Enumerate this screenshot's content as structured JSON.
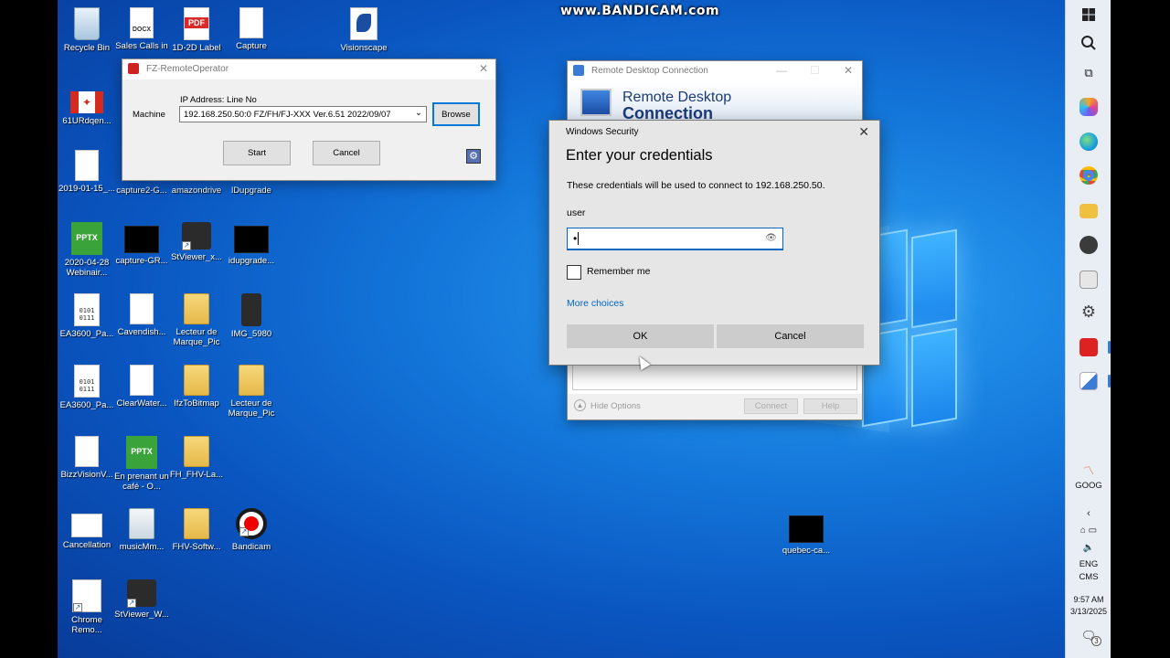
{
  "watermark": "www.BANDICAM.com",
  "desktop_icons": [
    {
      "label": "Recycle Bin",
      "kind": "recycle"
    },
    {
      "label": "Sales Calls in",
      "kind": "docx"
    },
    {
      "label": "1D-2D Label",
      "kind": "pdf"
    },
    {
      "label": "Capture",
      "kind": "doc"
    },
    {
      "label": "Visionscape",
      "kind": "vision"
    },
    {
      "label": "61URdqen...",
      "kind": "flag"
    },
    {
      "label": "2019-01-15_...",
      "kind": "doc"
    },
    {
      "label": "capture2-G...",
      "kind": "none"
    },
    {
      "label": "amazondrive",
      "kind": "none"
    },
    {
      "label": "lDupgrade",
      "kind": "none"
    },
    {
      "label": "2020-04-28 Webinair...",
      "kind": "pptx"
    },
    {
      "label": "capture-GR...",
      "kind": "black"
    },
    {
      "label": "StViewer_x...",
      "kind": "cam"
    },
    {
      "label": "idupgrade...",
      "kind": "black"
    },
    {
      "label": "EA3600_Pa...",
      "kind": "bin"
    },
    {
      "label": "Cavendish...",
      "kind": "doc"
    },
    {
      "label": "Lecteur de Marque_Pic",
      "kind": "folder"
    },
    {
      "label": "IMG_5980",
      "kind": "cam"
    },
    {
      "label": "EA3600_Pa...",
      "kind": "bin"
    },
    {
      "label": "ClearWater...",
      "kind": "doc"
    },
    {
      "label": "IfzToBitmap",
      "kind": "folder"
    },
    {
      "label": "Lecteur de Marque_Pic",
      "kind": "folder"
    },
    {
      "label": "BizzVisionV...",
      "kind": "doc"
    },
    {
      "label": "En prenant un café - O...",
      "kind": "pptx"
    },
    {
      "label": "FH_FHV-La...",
      "kind": "folder"
    },
    {
      "label": "Cancellation",
      "kind": "doc"
    },
    {
      "label": "musicMm...",
      "kind": "folder"
    },
    {
      "label": "FHV-Softw...",
      "kind": "folder"
    },
    {
      "label": "Bandicam",
      "kind": "bandicam"
    },
    {
      "label": "Chrome Remo...",
      "kind": "chromeapp"
    },
    {
      "label": "StViewer_W...",
      "kind": "cam"
    },
    {
      "label": "quebec-ca...",
      "kind": "black"
    }
  ],
  "fz_window": {
    "title": "FZ-RemoteOperator",
    "header_label": "IP Address: Line No",
    "machine_label": "Machine",
    "machine_value": "192.168.250.50:0 FZ/FH/FJ-XXX Ver.6.51 2022/09/07",
    "browse": "Browse",
    "start": "Start",
    "cancel": "Cancel"
  },
  "rdc_window": {
    "title": "Remote Desktop Connection",
    "banner_line1": "Remote Desktop",
    "banner_line2": "Connection",
    "hide_options": "Hide Options",
    "connect": "Connect",
    "help": "Help"
  },
  "security_dialog": {
    "title": "Windows Security",
    "heading": "Enter your credentials",
    "description": "These credentials will be used to connect to 192.168.250.50.",
    "username": "user",
    "password_mask": "•",
    "remember_me": "Remember me",
    "more_choices": "More choices",
    "ok": "OK",
    "cancel": "Cancel"
  },
  "taskbar": {
    "stock_label": "GOOG",
    "lang1": "ENG",
    "lang2": "CMS",
    "time": "9:57 AM",
    "date": "3/13/2025",
    "notification_count": "3"
  },
  "colors": {
    "accent": "#0067c0",
    "desktop": "#1478db",
    "taskbar": "#e9eef5"
  }
}
